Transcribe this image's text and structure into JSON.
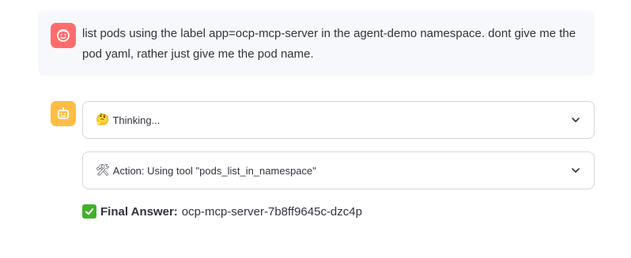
{
  "user_message": {
    "avatar_icon": "face-icon",
    "avatar_color": "#ff6c6c",
    "text": "list pods using the label app=ocp-mcp-server in the agent-demo namespace. dont give me the pod yaml, rather just give me the pod name."
  },
  "assistant": {
    "avatar_icon": "robot-icon",
    "avatar_color": "#ffbd45",
    "thinking": {
      "emoji": "🤔",
      "label": "Thinking..."
    },
    "action": {
      "emoji": "🛠",
      "label": "Action: Using tool \"pods_list_in_namespace\""
    },
    "final_answer": {
      "icon": "check-mark-icon",
      "label": "Final Answer:",
      "value": "ocp-mcp-server-7b8ff9645c-dzc4p"
    }
  }
}
